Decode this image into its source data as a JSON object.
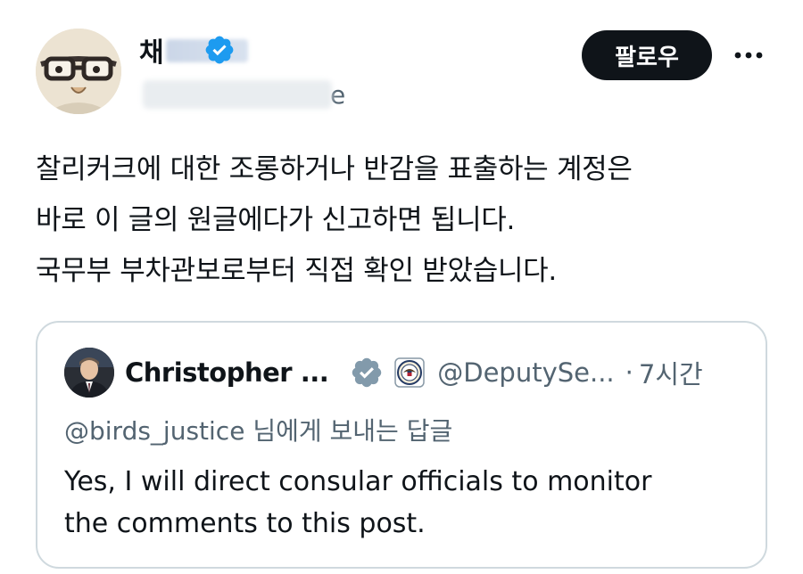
{
  "post": {
    "author": {
      "display_name": "채",
      "handle_visible": "e",
      "avatar": "glasses-character-avatar",
      "verified_icon": "verified-badge-icon"
    },
    "follow_label": "팔로우",
    "more_icon": "more-icon",
    "body_lines": [
      "찰리커크에 대한 조롱하거나 반감을 표출하는 계정은",
      "바로 이 글의 원글에다가 신고하면 됩니다.",
      "국무부 부차관보로부터 직접 확인 받았습니다."
    ]
  },
  "quote": {
    "name": "Christopher ...",
    "badge_icon": "government-badge-icon",
    "seal_icon": "state-department-seal-icon",
    "handle": "@DeputySe...",
    "dot": "·",
    "time": "7시간",
    "reply_handle": "@birds_justice",
    "reply_suffix": " 님에게 보내는 답글",
    "text_lines": [
      "Yes, I will direct consular officials to monitor",
      "the comments to this post."
    ]
  },
  "colors": {
    "text": "#0f1419",
    "secondary": "#536471",
    "verified_blue": "#1d9bf0",
    "government_grey": "#829aab",
    "border": "#cfd9de",
    "button_bg": "#0f1419"
  }
}
